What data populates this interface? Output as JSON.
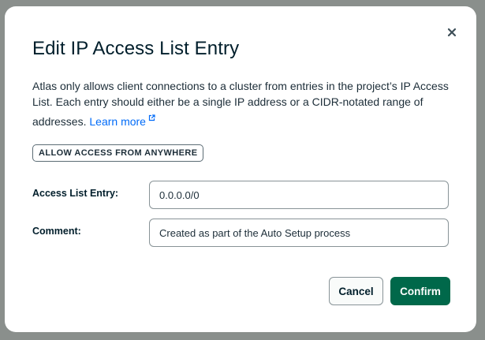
{
  "modal": {
    "title": "Edit IP Access List Entry",
    "description": "Atlas only allows client connections to a cluster from entries in the project’s IP Access List. Each entry should either be a single IP address or a CIDR-notated range of addresses.",
    "learn_more_label": "Learn more",
    "close_icon": "close-icon",
    "external_link_icon": "external-link-icon"
  },
  "allow_anywhere_button": {
    "label": "ALLOW ACCESS FROM ANYWHERE"
  },
  "fields": {
    "access_list_entry": {
      "label": "Access List Entry:",
      "value": "0.0.0.0/0"
    },
    "comment": {
      "label": "Comment:",
      "value": "Created as part of the Auto Setup process"
    }
  },
  "actions": {
    "cancel_label": "Cancel",
    "confirm_label": "Confirm"
  },
  "colors": {
    "confirm_button": "#00684a",
    "link": "#016bf8",
    "backdrop": "#8a8f8c"
  }
}
